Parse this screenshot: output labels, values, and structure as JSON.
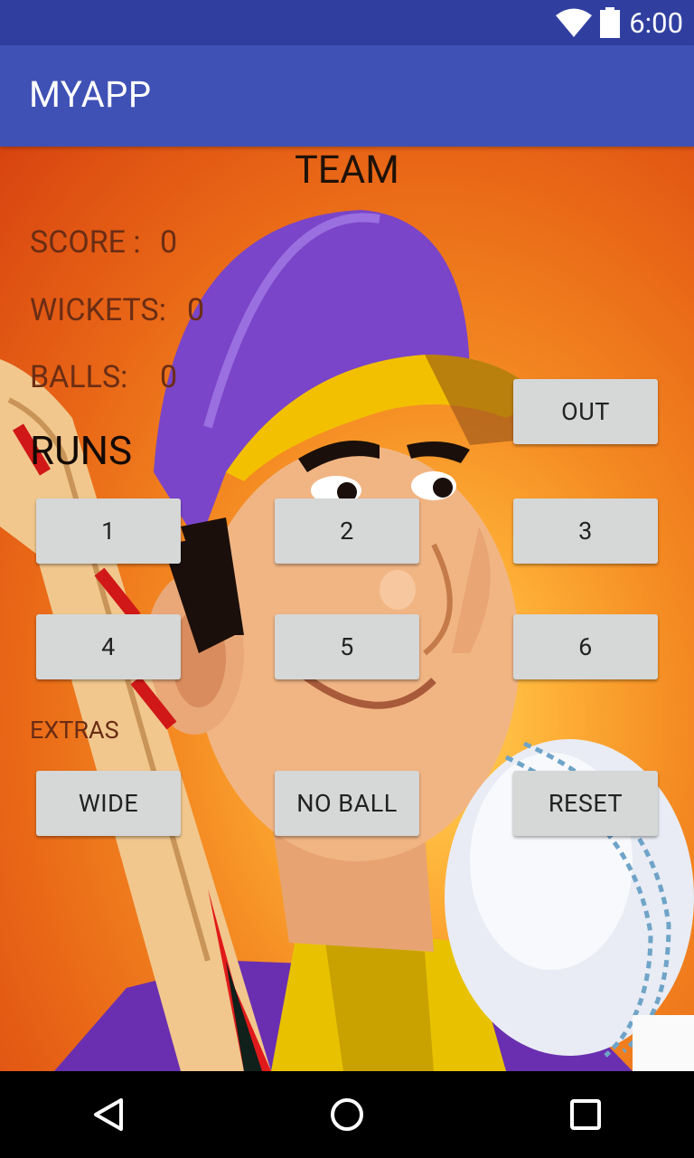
{
  "status_bar": {
    "time": "6:00",
    "icons": [
      "wifi-icon",
      "battery-icon"
    ]
  },
  "app_bar": {
    "title": "MYAPP",
    "color": "#3f51b5"
  },
  "main": {
    "team_title": "TEAM",
    "score": {
      "label": "SCORE :",
      "value": "0"
    },
    "wickets": {
      "label": "WICKETS:",
      "value": "0"
    },
    "balls": {
      "label": "BALLS:",
      "value": "0"
    },
    "out_button": "OUT",
    "runs_label": "RUNS",
    "run_buttons": [
      "1",
      "2",
      "3",
      "4",
      "5",
      "6"
    ],
    "extras_label": "EXTRAS",
    "extras_buttons": {
      "wide": "WIDE",
      "no_ball": "NO BALL",
      "reset": "RESET"
    }
  },
  "nav_bar": {
    "icons": [
      "back-icon",
      "home-icon",
      "recents-icon"
    ]
  }
}
